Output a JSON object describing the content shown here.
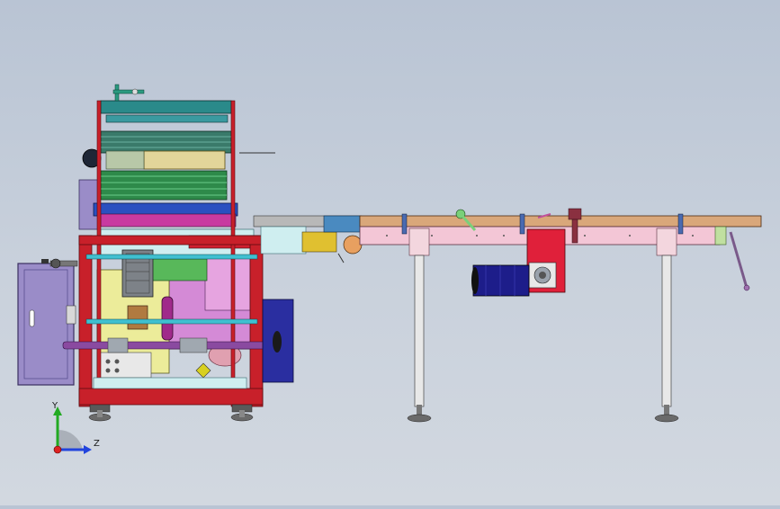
{
  "triad": {
    "y_label": "Y",
    "z_label": "Z",
    "colors": {
      "y_axis": "#22aa22",
      "z_axis": "#2244dd",
      "x_axis": "#dd2222"
    }
  },
  "colors": {
    "frame_red": "#c8202a",
    "conveyor_tan": "#d9a77a",
    "conveyor_pink": "#f3c6d6",
    "motor_blue": "#1d1d8a",
    "gearbox_red": "#e0203a",
    "panel_lavender": "#9a8cc8",
    "roller_green": "#2e8a4a"
  }
}
